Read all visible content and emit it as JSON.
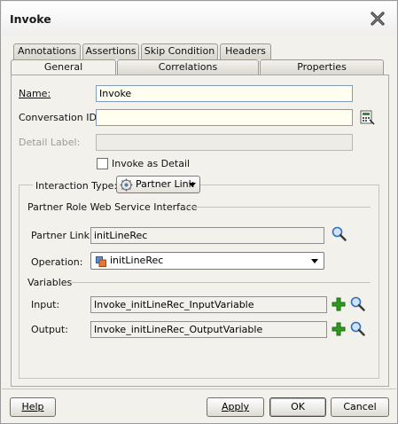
{
  "window": {
    "title": "Invoke"
  },
  "tabs": {
    "back": [
      "Annotations",
      "Assertions",
      "Skip Condition",
      "Headers"
    ],
    "front": [
      "General",
      "Correlations",
      "Properties"
    ]
  },
  "general": {
    "name_label": "Name:",
    "name_value": "Invoke",
    "conversation_label": "Conversation ID:",
    "conversation_value": "",
    "detail_label": "Detail Label:",
    "detail_value": "",
    "invoke_as_detail": "Invoke as Detail"
  },
  "interaction": {
    "type_label": "Interaction Type:",
    "type_value": "Partner Link",
    "section_title": "Partner Role Web Service Interface",
    "partner_link_label": "Partner Link:",
    "partner_link_value": "initLineRec",
    "operation_label": "Operation:",
    "operation_value": "initLineRec"
  },
  "variables": {
    "section_title": "Variables",
    "input_label": "Input:",
    "input_value": "Invoke_initLineRec_InputVariable",
    "output_label": "Output:",
    "output_value": "Invoke_initLineRec_OutputVariable"
  },
  "buttons": {
    "help": "Help",
    "apply": "Apply",
    "ok": "OK",
    "cancel": "Cancel"
  },
  "colors": {
    "add_icon": "#2e9b1f",
    "search_icon": "#2f6fbf",
    "field_bg": "#fffef1"
  }
}
